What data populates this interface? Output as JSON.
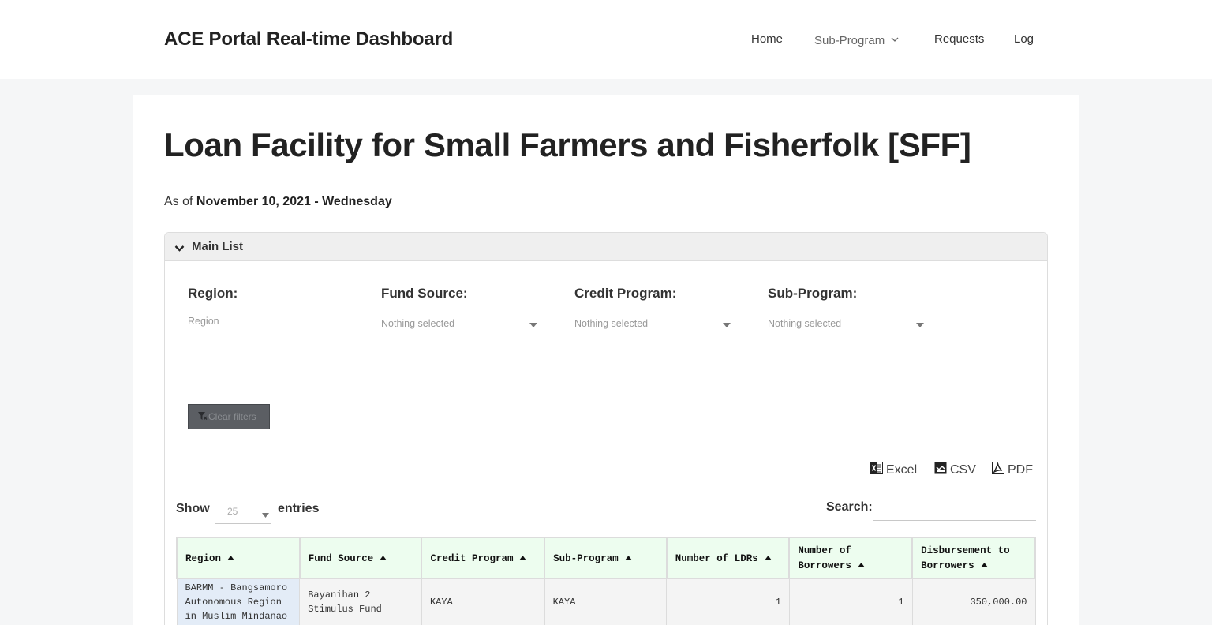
{
  "header": {
    "brand": "ACE Portal Real-time Dashboard",
    "nav": {
      "home": "Home",
      "sub_program": "Sub-Program",
      "requests": "Requests",
      "log": "Log"
    }
  },
  "page": {
    "title": "Loan Facility for Small Farmers and Fisherfolk [SFF]",
    "as_of_prefix": "As of",
    "as_of_date": "November 10, 2021 - Wednesday"
  },
  "panel": {
    "title": "Main List"
  },
  "filters": {
    "region": {
      "label": "Region:",
      "placeholder": "Region"
    },
    "fund_source": {
      "label": "Fund Source:",
      "value": "Nothing selected"
    },
    "credit_program": {
      "label": "Credit Program:",
      "value": "Nothing selected"
    },
    "sub_program": {
      "label": "Sub-Program:",
      "value": "Nothing selected"
    },
    "clear_label": "Clear filters"
  },
  "export": {
    "excel": "Excel",
    "csv": "CSV",
    "pdf": "PDF"
  },
  "table_controls": {
    "show_label": "Show",
    "page_size": "25",
    "entries_label": "entries",
    "search_label": "Search:"
  },
  "table": {
    "columns": [
      "Region",
      "Fund Source",
      "Credit Program",
      "Sub-Program",
      "Number of LDRs",
      "Number of Borrowers",
      "Disbursement to Borrowers"
    ],
    "rows": [
      {
        "region": "BARMM - Bangsamoro Autonomous Region in Muslim Mindanao",
        "fund_source": "Bayanihan 2 Stimulus Fund",
        "credit_program": "KAYA",
        "sub_program": "KAYA",
        "ldrs": "1",
        "borrowers": "1",
        "disbursement": "350,000.00"
      }
    ]
  },
  "colors": {
    "header_bg": "#edfdef",
    "first_col_bg": "#e3ecf7",
    "clear_button_bg": "#5b5e63"
  }
}
